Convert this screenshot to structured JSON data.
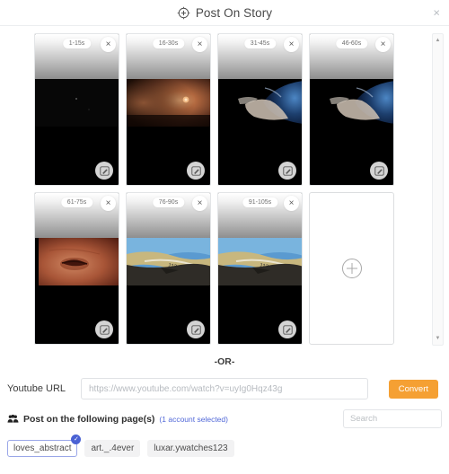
{
  "header": {
    "title": "Post On Story",
    "icon": "add-story-icon",
    "close_label": "×"
  },
  "frames": [
    {
      "label": "1-15s",
      "close_label": "×",
      "image": "dark-night-sky",
      "colors": [
        "#050505",
        "#0a0a0a",
        "#000000"
      ]
    },
    {
      "label": "16-30s",
      "close_label": "×",
      "image": "orange-nebula",
      "colors": [
        "#6d3c25",
        "#c87a42",
        "#1a0c06"
      ]
    },
    {
      "label": "31-45s",
      "close_label": "×",
      "image": "earth-from-space",
      "colors": [
        "#0b1b33",
        "#2d5e96",
        "#d8cfc4"
      ]
    },
    {
      "label": "46-60s",
      "close_label": "×",
      "image": "earth-from-space",
      "colors": [
        "#0b1b33",
        "#2d5e96",
        "#d8cfc4"
      ]
    },
    {
      "label": "61-75s",
      "close_label": "×",
      "image": "eye-closeup",
      "colors": [
        "#7b2a1c",
        "#c96a4a",
        "#3a1009"
      ]
    },
    {
      "label": "76-90s",
      "close_label": "×",
      "image": "aerial-landscape",
      "colors": [
        "#4e93c9",
        "#c6b27a",
        "#2c2a26"
      ]
    },
    {
      "label": "91-105s",
      "close_label": "×",
      "image": "aerial-landscape",
      "colors": [
        "#4e93c9",
        "#c6b27a",
        "#2c2a26"
      ]
    }
  ],
  "add_slot": {
    "icon": "plus-circle-icon"
  },
  "scrollbar": {
    "up": "▲",
    "down": "▼"
  },
  "divider": {
    "text": "-OR-"
  },
  "youtube": {
    "label": "Youtube URL",
    "placeholder": "https://www.youtube.com/watch?v=uyIg0Hqz43g",
    "value": "",
    "convert_label": "Convert",
    "convert_color": "#f5a033"
  },
  "accounts": {
    "icon": "people-icon",
    "title": "Post on the following page(s)",
    "count_text": "(1 account selected)",
    "count_color": "#5168d8",
    "search_placeholder": "Search",
    "search_value": "",
    "chips": [
      {
        "name": "loves_abstract",
        "selected": true,
        "check": "✓"
      },
      {
        "name": "art._.4ever",
        "selected": false
      },
      {
        "name": "luxar.ywatches123",
        "selected": false
      }
    ]
  }
}
